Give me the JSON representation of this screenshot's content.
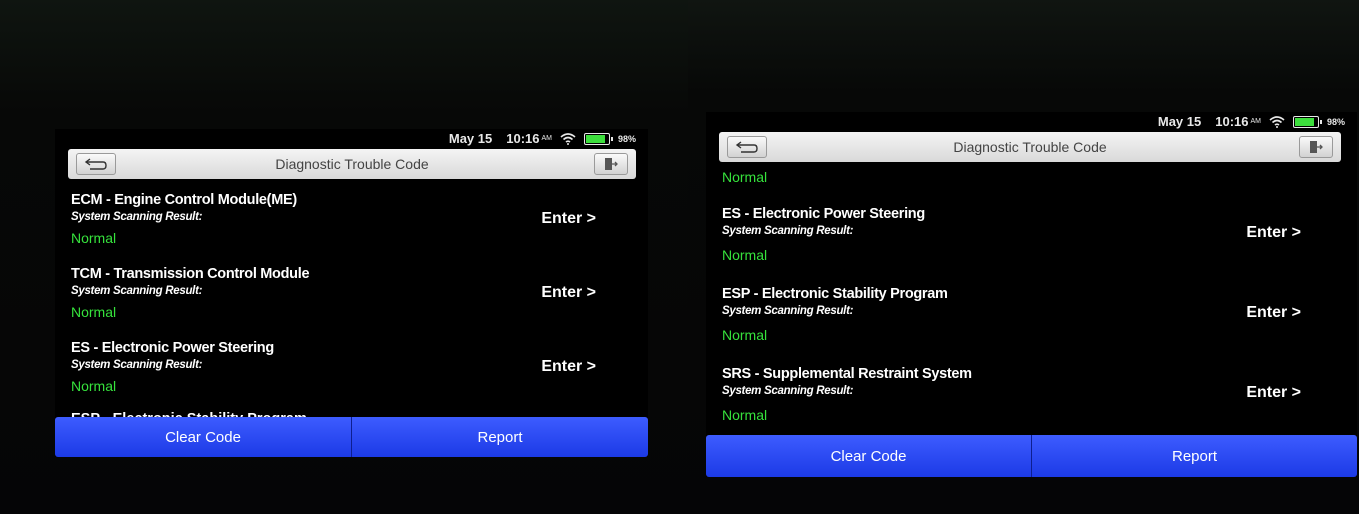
{
  "status": {
    "date": "May 15",
    "time": "10:16",
    "ampm": "AM",
    "battery": "98%"
  },
  "title": "Diagnostic Trouble Code",
  "result_label": "System Scanning Result:",
  "enter_label": "Enter >",
  "buttons": {
    "clear_code": "Clear Code",
    "report": "Report"
  },
  "left_screen": {
    "modules": [
      {
        "name": "ECM - Engine Control Module(ME)",
        "result": "Normal"
      },
      {
        "name": "TCM - Transmission Control Module",
        "result": "Normal"
      },
      {
        "name": "ES - Electronic Power Steering",
        "result": "Normal"
      }
    ],
    "partial_next": "ESP - Electronic Stability Program"
  },
  "right_screen": {
    "partial_prev_result": "Normal",
    "modules": [
      {
        "name": "ES - Electronic Power Steering",
        "result": "Normal"
      },
      {
        "name": "ESP - Electronic Stability Program",
        "result": "Normal"
      },
      {
        "name": "SRS - Supplemental Restraint System",
        "result": "Normal"
      }
    ]
  },
  "colors": {
    "normal": "#36e23c",
    "button_blue": "#2747f2",
    "titlebar": "#e6e6e6"
  },
  "icons": [
    "back-arrow-icon",
    "exit-icon",
    "wifi-icon",
    "battery-icon"
  ]
}
